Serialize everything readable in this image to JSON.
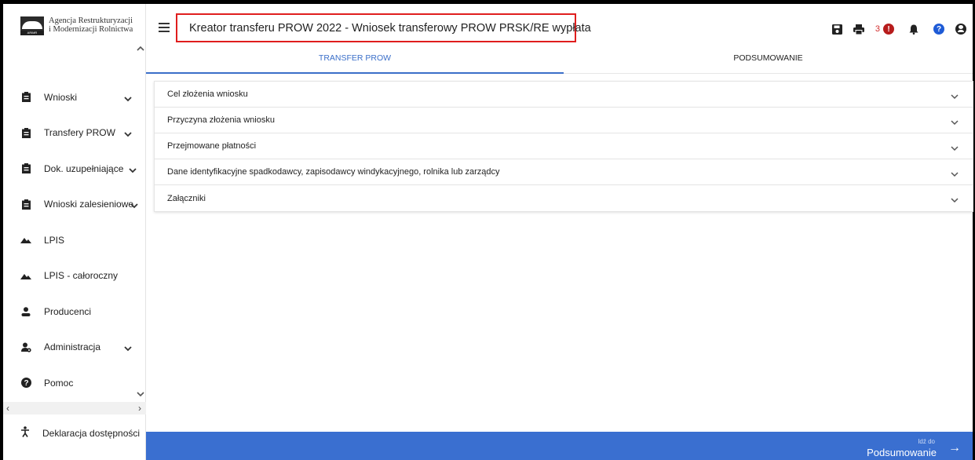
{
  "brand": {
    "logo_line1": "Agencja Restrukturyzacji",
    "logo_line2": "i Modernizacji Rolnictwa",
    "logo_mark_text": "ARiMR"
  },
  "header": {
    "title": "Kreator transferu PROW 2022 - Wniosek transferowy PROW PRSK/RE wypłata",
    "notification_count": "3"
  },
  "sidebar": {
    "items": [
      {
        "label": "Wnioski",
        "icon": "clipboard-icon",
        "has_chevron": true
      },
      {
        "label": "Transfery PROW",
        "icon": "clipboard-icon",
        "has_chevron": true
      },
      {
        "label": "Dok. uzupełniające",
        "icon": "clipboard-icon",
        "has_chevron": true
      },
      {
        "label": "Wnioski zalesieniowe",
        "icon": "clipboard-icon",
        "has_chevron": true
      },
      {
        "label": "LPIS",
        "icon": "mountain-icon",
        "has_chevron": false
      },
      {
        "label": "LPIS - całoroczny",
        "icon": "mountain-icon",
        "has_chevron": false
      },
      {
        "label": "Producenci",
        "icon": "user-icon",
        "has_chevron": false
      },
      {
        "label": "Administracja",
        "icon": "user-cog-icon",
        "has_chevron": true
      },
      {
        "label": "Pomoc",
        "icon": "help-icon",
        "has_chevron": false
      }
    ],
    "accessibility": "Deklaracja dostępności"
  },
  "tabs": [
    {
      "label": "TRANSFER PROW",
      "active": true
    },
    {
      "label": "PODSUMOWANIE",
      "active": false
    }
  ],
  "sections": [
    "Cel złożenia wniosku",
    "Przyczyna złożenia wniosku",
    "Przejmowane płatności",
    "Dane identyfikacyjne spadkodawcy, zapisodawcy windykacyjnego, rolnika lub zarządcy",
    "Załączniki"
  ],
  "footer": {
    "goto_small": "Idź do",
    "goto_big": "Podsumowanie"
  },
  "colors": {
    "accent": "#3a6fd0",
    "highlight_border": "#e01e1e",
    "alert": "#b71c1c",
    "help": "#1e5bd6"
  }
}
